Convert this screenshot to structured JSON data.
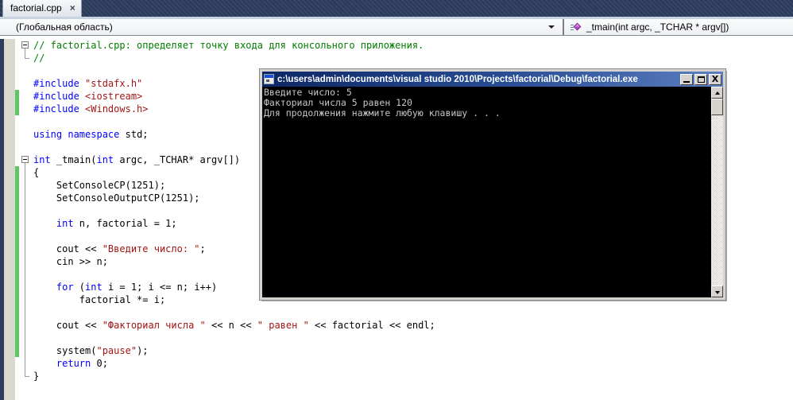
{
  "colors": {
    "kw": "#0000ff",
    "str": "#a31515",
    "com": "#007d00",
    "chg": "#5fc765",
    "navy": "#2c3b59",
    "frame": "#d6d3ce"
  },
  "tab_bar": {
    "active_tab": {
      "label": "factorial.cpp",
      "close_glyph": "×"
    }
  },
  "nav_bar": {
    "scope_label": "(Глобальная область)",
    "member_label": "_tmain(int argc, _TCHAR * argv[])"
  },
  "editor": {
    "lines": [
      {
        "segs": [
          {
            "c": "com",
            "t": "// factorial.cpp: определяет точку входа для консольного приложения."
          }
        ]
      },
      {
        "segs": [
          {
            "c": "com",
            "t": "//"
          }
        ]
      },
      {
        "segs": []
      },
      {
        "segs": [
          {
            "c": "kw",
            "t": "#include"
          },
          {
            "c": "pl",
            "t": " "
          },
          {
            "c": "str",
            "t": "\"stdafx.h\""
          }
        ]
      },
      {
        "segs": [
          {
            "c": "kw",
            "t": "#include"
          },
          {
            "c": "pl",
            "t": " "
          },
          {
            "c": "str",
            "t": "<iostream>"
          }
        ]
      },
      {
        "segs": [
          {
            "c": "kw",
            "t": "#include"
          },
          {
            "c": "pl",
            "t": " "
          },
          {
            "c": "str",
            "t": "<Windows.h>"
          }
        ]
      },
      {
        "segs": []
      },
      {
        "segs": [
          {
            "c": "kw",
            "t": "using"
          },
          {
            "c": "pl",
            "t": " "
          },
          {
            "c": "kw",
            "t": "namespace"
          },
          {
            "c": "pl",
            "t": " std;"
          }
        ]
      },
      {
        "segs": []
      },
      {
        "segs": [
          {
            "c": "kw",
            "t": "int"
          },
          {
            "c": "pl",
            "t": " _tmain("
          },
          {
            "c": "kw",
            "t": "int"
          },
          {
            "c": "pl",
            "t": " argc, _TCHAR* argv[])"
          }
        ]
      },
      {
        "segs": [
          {
            "c": "pl",
            "t": "{"
          }
        ]
      },
      {
        "segs": [
          {
            "c": "pl",
            "t": "    SetConsoleCP(1251);"
          }
        ]
      },
      {
        "segs": [
          {
            "c": "pl",
            "t": "    SetConsoleOutputCP(1251);"
          }
        ]
      },
      {
        "segs": []
      },
      {
        "segs": [
          {
            "c": "kw",
            "t": "    int"
          },
          {
            "c": "pl",
            "t": " n, factorial = 1;"
          }
        ]
      },
      {
        "segs": []
      },
      {
        "segs": [
          {
            "c": "pl",
            "t": "    cout << "
          },
          {
            "c": "str",
            "t": "\"Введите число: \""
          },
          {
            "c": "pl",
            "t": ";"
          }
        ]
      },
      {
        "segs": [
          {
            "c": "pl",
            "t": "    cin >> n;"
          }
        ]
      },
      {
        "segs": []
      },
      {
        "segs": [
          {
            "c": "kw",
            "t": "    for"
          },
          {
            "c": "pl",
            "t": " ("
          },
          {
            "c": "kw",
            "t": "int"
          },
          {
            "c": "pl",
            "t": " i = 1; i <= n; i++)"
          }
        ]
      },
      {
        "segs": [
          {
            "c": "pl",
            "t": "        factorial *= i;"
          }
        ]
      },
      {
        "segs": []
      },
      {
        "segs": [
          {
            "c": "pl",
            "t": "    cout << "
          },
          {
            "c": "str",
            "t": "\"Факториал числа \""
          },
          {
            "c": "pl",
            "t": " << n << "
          },
          {
            "c": "str",
            "t": "\" равен \""
          },
          {
            "c": "pl",
            "t": " << factorial << endl;"
          }
        ]
      },
      {
        "segs": []
      },
      {
        "segs": [
          {
            "c": "pl",
            "t": "    system("
          },
          {
            "c": "str",
            "t": "\"pause\""
          },
          {
            "c": "pl",
            "t": ");"
          }
        ]
      },
      {
        "segs": [
          {
            "c": "kw",
            "t": "    return"
          },
          {
            "c": "pl",
            "t": " 0;"
          }
        ]
      },
      {
        "segs": [
          {
            "c": "pl",
            "t": "}"
          }
        ]
      }
    ],
    "change_bars": [
      {
        "from": 5,
        "to": 6
      },
      {
        "from": 11,
        "to": 25
      }
    ],
    "fold_markers": [
      {
        "line": 1
      },
      {
        "line": 10
      }
    ],
    "fold_lines": [
      {
        "from_line": 1,
        "to_line": 2
      },
      {
        "from_line": 10,
        "to_line": 27
      }
    ]
  },
  "console": {
    "title": "c:\\users\\admin\\documents\\visual studio 2010\\Projects\\factorial\\Debug\\factorial.exe",
    "lines": [
      "Введите число: 5",
      "Факториал числа 5 равен 120",
      "Для продолжения нажмите любую клавишу . . ."
    ]
  }
}
